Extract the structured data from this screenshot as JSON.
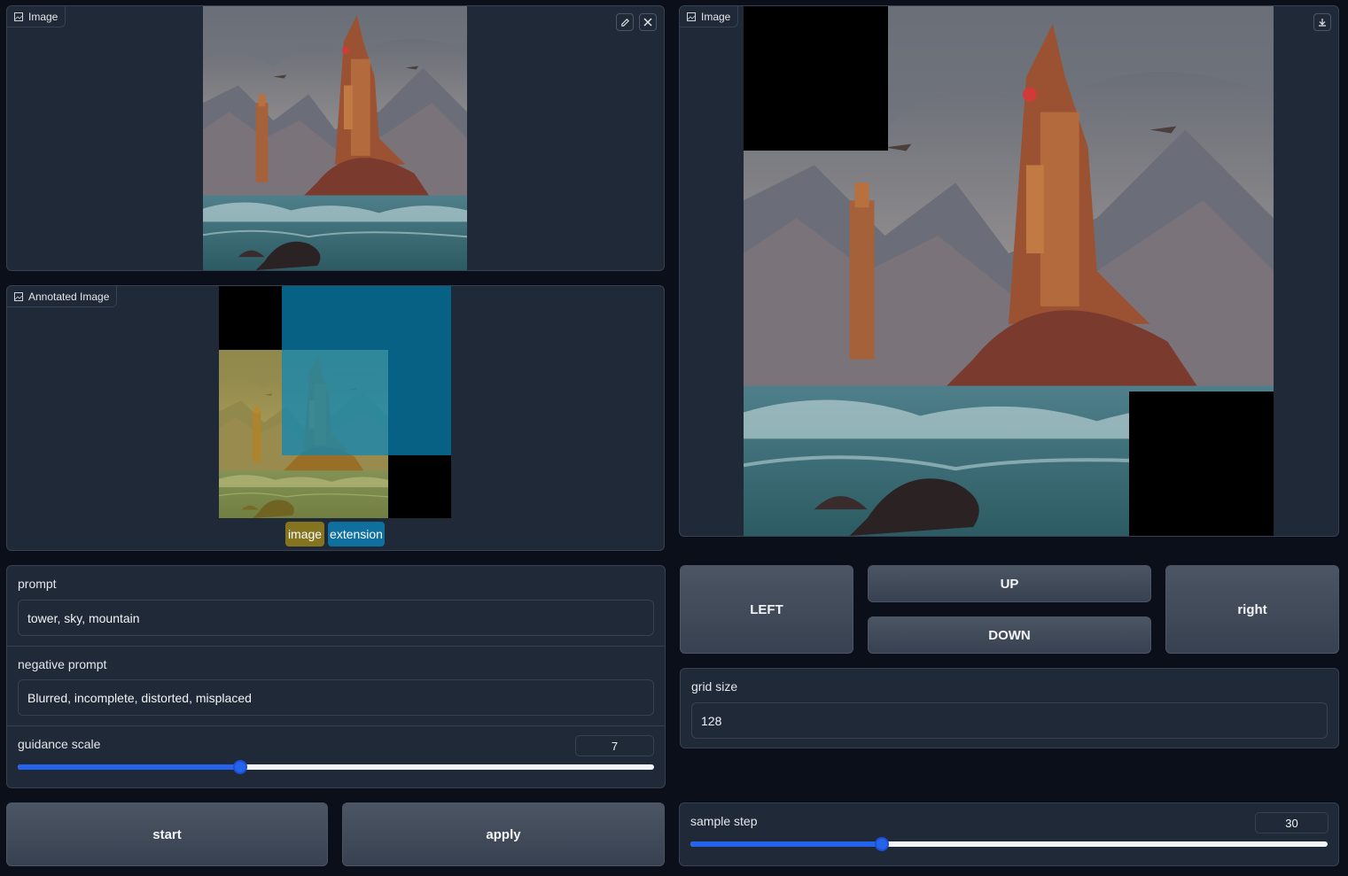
{
  "input_image": {
    "label": "Image",
    "icons": [
      "image-icon",
      "edit-icon",
      "close-icon"
    ]
  },
  "annotated_image": {
    "label": "Annotated Image",
    "legend": [
      {
        "label": "image",
        "color": "#85741f"
      },
      {
        "label": "extension",
        "color": "#0f6f9e"
      }
    ]
  },
  "output_image": {
    "label": "Image",
    "icons": [
      "image-icon",
      "download-icon"
    ]
  },
  "prompt": {
    "label": "prompt",
    "value": "tower, sky, mountain"
  },
  "negative_prompt": {
    "label": "negative prompt",
    "value": "Blurred, incomplete, distorted, misplaced"
  },
  "guidance_scale": {
    "label": "guidance scale",
    "value": "7",
    "fraction": 0.35
  },
  "buttons": {
    "start": "start",
    "apply": "apply",
    "left": "LEFT",
    "up": "UP",
    "down": "DOWN",
    "right": "right"
  },
  "grid_size": {
    "label": "grid size",
    "value": "128"
  },
  "sample_step": {
    "label": "sample step",
    "value": "30",
    "fraction": 0.3
  },
  "colors": {
    "background": "#0b0f19",
    "panel": "#1f2937",
    "accent": "#2563eb"
  }
}
